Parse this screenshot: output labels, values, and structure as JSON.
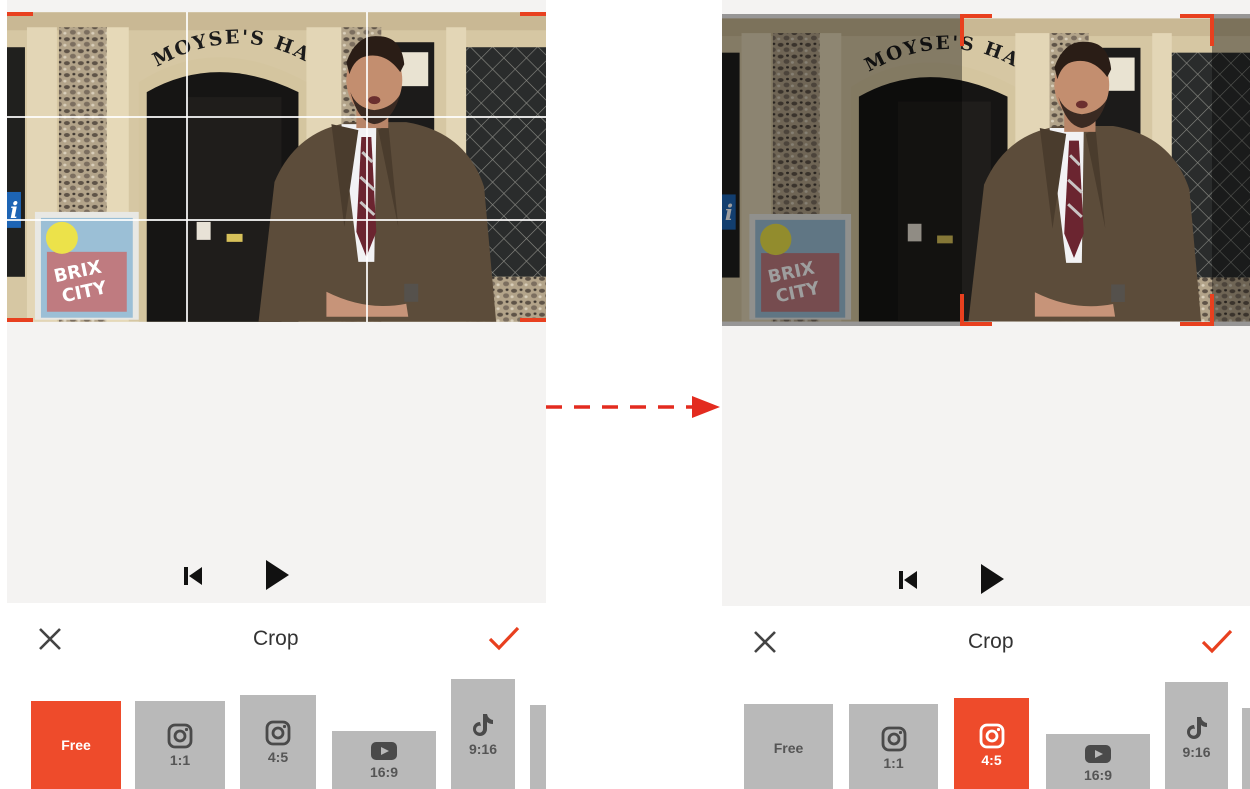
{
  "colors": {
    "accent": "#ee4b2b",
    "panel_bg": "#f4f3f2",
    "button_inactive": "#b9b9b9",
    "toolbar_bg": "#ffffff"
  },
  "video": {
    "sign_text": "MOYSE'S HALL",
    "poster_text": "BRIX CITY"
  },
  "left": {
    "title": "Crop",
    "cancel_icon": "close-icon",
    "confirm_icon": "check-icon",
    "playback_icons": [
      "skip-to-start-icon",
      "play-icon"
    ],
    "ratios": [
      {
        "label": "Free",
        "icon": "",
        "active": true
      },
      {
        "label": "1:1",
        "icon": "instagram-icon",
        "active": false
      },
      {
        "label": "4:5",
        "icon": "instagram-icon",
        "active": false
      },
      {
        "label": "16:9",
        "icon": "youtube-icon",
        "active": false
      },
      {
        "label": "9:16",
        "icon": "tiktok-icon",
        "active": false
      }
    ]
  },
  "right": {
    "title": "Crop",
    "cancel_icon": "close-icon",
    "confirm_icon": "check-icon",
    "playback_icons": [
      "skip-to-start-icon",
      "play-icon"
    ],
    "ratios": [
      {
        "label": "Free",
        "icon": "",
        "active": false
      },
      {
        "label": "1:1",
        "icon": "instagram-icon",
        "active": false
      },
      {
        "label": "4:5",
        "icon": "instagram-icon",
        "active": true
      },
      {
        "label": "16:9",
        "icon": "youtube-icon",
        "active": false
      },
      {
        "label": "9:16",
        "icon": "tiktok-icon",
        "active": false
      }
    ]
  },
  "transition_arrow": "dashed-arrow-icon"
}
